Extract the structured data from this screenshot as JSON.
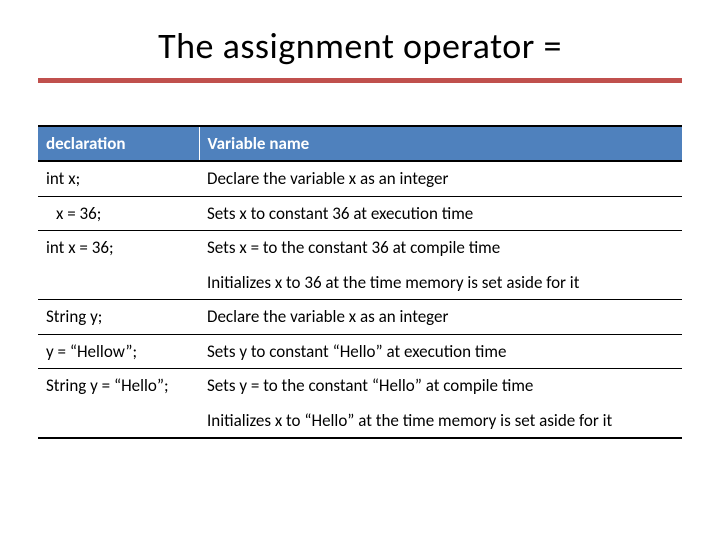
{
  "title": "The assignment operator    =",
  "headers": {
    "col1": "declaration",
    "col2": "Variable name"
  },
  "rows": [
    {
      "c1": "int x;",
      "c2": "Declare the variable x as an integer",
      "indent": false
    },
    {
      "c1": "x = 36;",
      "c2": "Sets x to constant 36 at execution time",
      "indent": true
    },
    {
      "c1": "int x = 36;",
      "c2": "Sets x = to the constant 36 at compile time\n\nInitializes x to 36 at the time memory is set aside for it",
      "indent": false
    },
    {
      "c1": "String  y;",
      "c2": "Declare the variable x as an integer",
      "indent": false
    },
    {
      "c1": "y = “Hellow”;",
      "c2": "Sets y to constant  “Hello” at execution time",
      "indent": false
    },
    {
      "c1": "String y = “Hello”;",
      "c2": "Sets y = to the constant “Hello” at compile time\n\nInitializes x to “Hello” at the time memory is set aside for it",
      "indent": false
    }
  ]
}
